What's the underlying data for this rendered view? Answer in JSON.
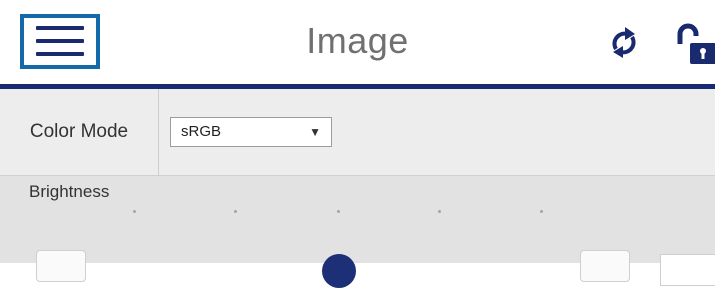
{
  "header": {
    "title": "Image",
    "menu_icon": "hamburger-menu-icon",
    "refresh_icon": "refresh-icon",
    "lock_icon": "unlocked-padlock-icon"
  },
  "colors": {
    "accent": "#172a73",
    "menu_highlight": "#1469a8",
    "title_text": "#707070"
  },
  "color_mode": {
    "label": "Color Mode",
    "selected": "sRGB",
    "dropdown_arrow": "▼"
  },
  "brightness": {
    "label": "Brightness"
  }
}
